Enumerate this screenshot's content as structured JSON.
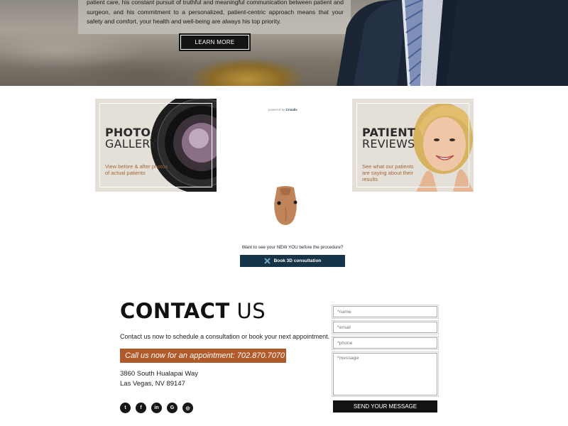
{
  "hero": {
    "paragraph": "patient care, his constant pursuit of truthful and meaningful communication between patient and surgeon, and his commitment to a personalized, patient-centric approach means that your safety and comfort, your health and well-being are always his top priority.",
    "learn_more_label": "LEARN MORE"
  },
  "cards": {
    "gallery": {
      "title_bold": "PHOTO",
      "title_light": "GALLERY",
      "description": "View before & after photos of actual patients"
    },
    "reviews": {
      "title_bold": "PATIENT",
      "title_light": "REVIEWS",
      "description": "See what our patients are saying about their results"
    }
  },
  "crisalix": {
    "powered_by": "powered by",
    "brand": "Crisalix",
    "prompt": "Want to see your NEW YOU before the procedure?",
    "book_label": "Book 3D consultation",
    "book_icon": "crisalix-x-icon"
  },
  "contact": {
    "title_bold": "CONTACT",
    "title_light": "US",
    "intro": "Contact us now to schedule a consultation or book your next appointment.",
    "call_text": "Call us now for an appointment: 702.870.7070",
    "address_line1": "3860 South Hualapai Way",
    "address_line2": "Las Vegas, NV 89147",
    "socials": [
      {
        "icon": "twitter-icon",
        "glyph": "t"
      },
      {
        "icon": "facebook-icon",
        "glyph": "f"
      },
      {
        "icon": "linkedin-icon",
        "glyph": "in"
      },
      {
        "icon": "google-icon",
        "glyph": "G"
      },
      {
        "icon": "instagram-icon",
        "glyph": "◎"
      }
    ]
  },
  "form": {
    "name_placeholder": "*name",
    "email_placeholder": "*email",
    "phone_placeholder": "*phone",
    "message_placeholder": "*message",
    "send_label": "SEND YOUR MESSAGE"
  },
  "colors": {
    "accent_rust": "#b05a2c",
    "button_dark": "#131313",
    "crisalix_navy": "#163447"
  }
}
